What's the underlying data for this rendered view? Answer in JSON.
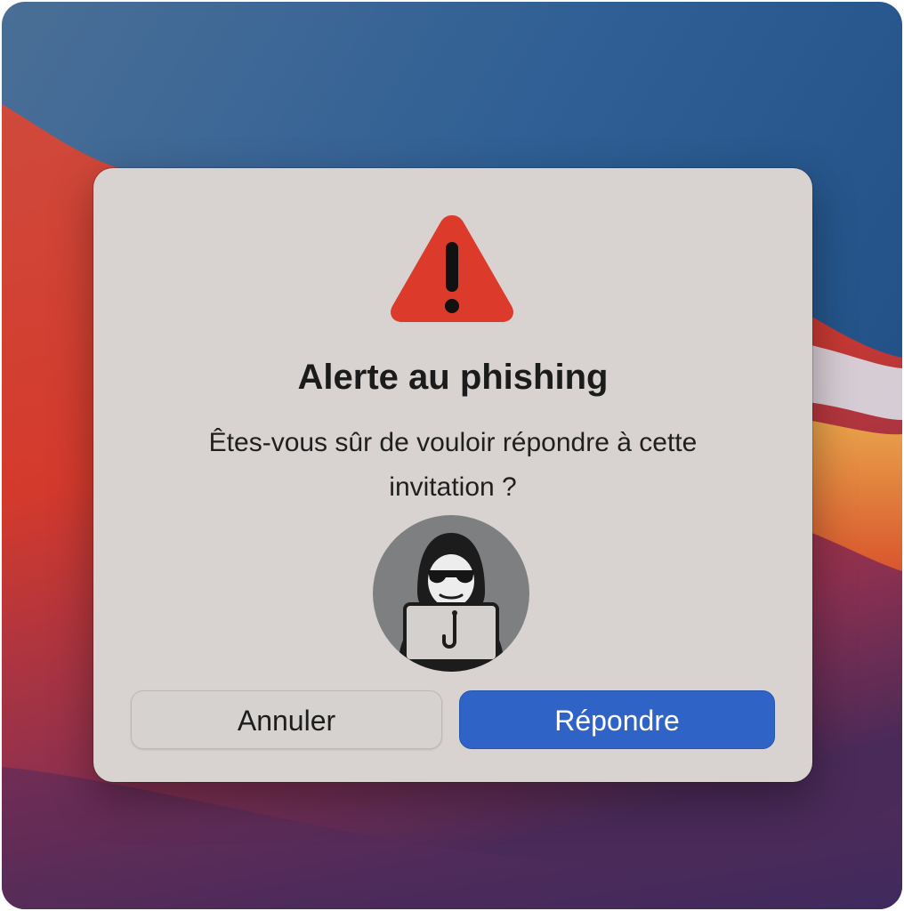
{
  "colors": {
    "dialog_background": "#d8d3d0",
    "warning_red": "#dc3b2c",
    "primary_button": "#2f63c6",
    "cancel_button": "#d6d2cf",
    "wallpaper_blue": "#2f5f95",
    "wallpaper_red": "#d43a2c",
    "wallpaper_orange": "#e58a35",
    "wallpaper_purple": "#5b2a5a"
  },
  "icons": {
    "alert": "warning-triangle-icon",
    "illustration": "hooded-hacker-with-fishhook-laptop"
  },
  "dialog": {
    "title": "Alerte au phishing",
    "message": "Êtes-vous sûr de vouloir répondre à cette invitation ?",
    "buttons": {
      "cancel_label": "Annuler",
      "confirm_label": "Répondre"
    }
  }
}
